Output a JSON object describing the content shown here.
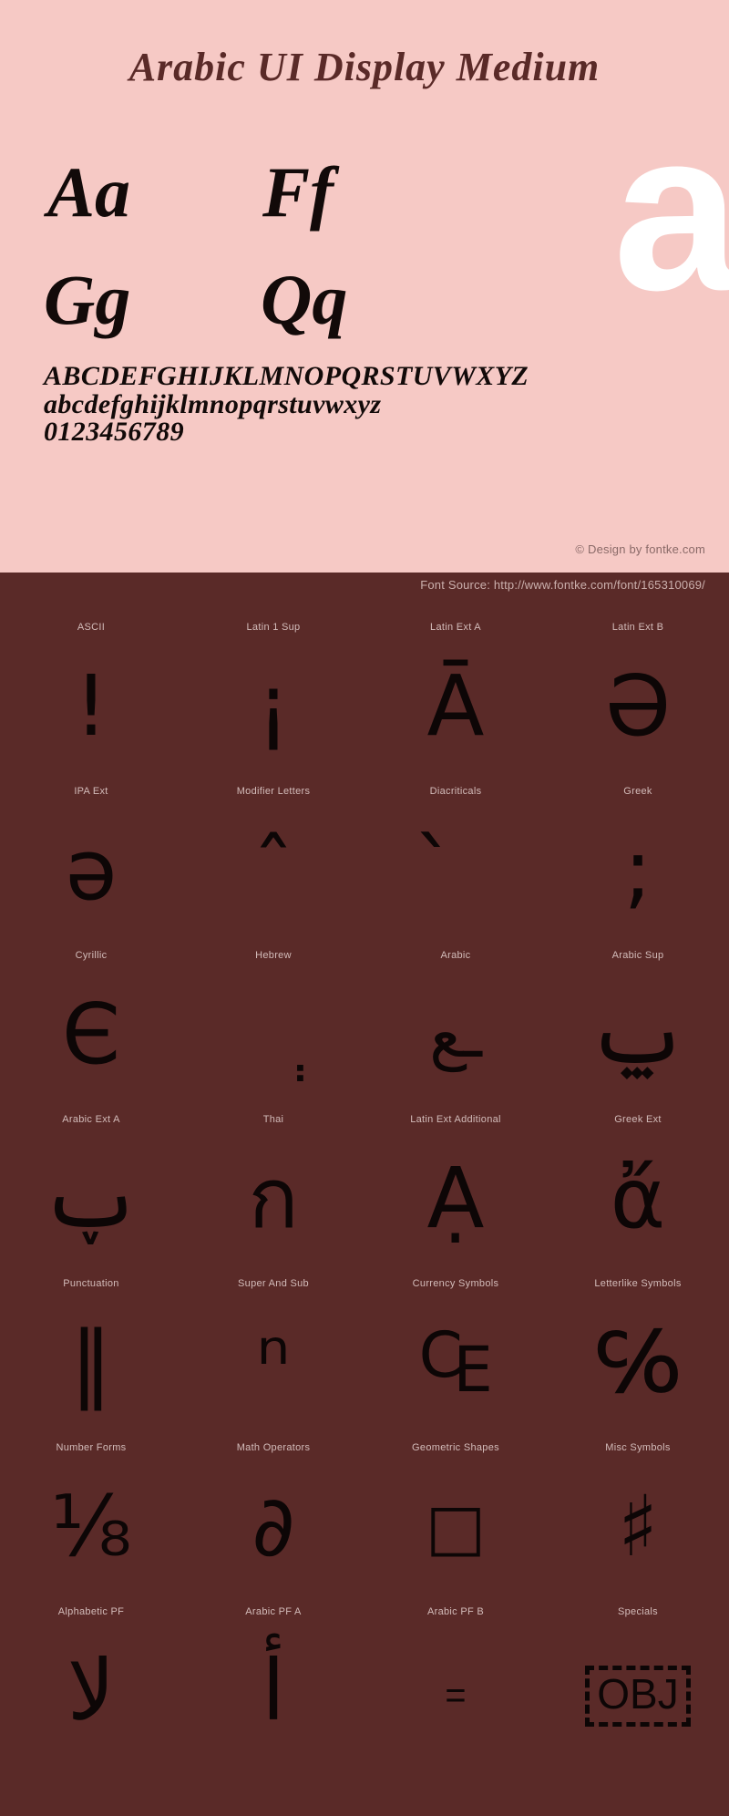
{
  "colors": {
    "panel_bg": "#f6c9c5",
    "page_bg": "#5a2a28",
    "ink": "#0d0606",
    "showcase": "#ffffff",
    "label": "#d3bcba"
  },
  "specimen": {
    "title": "Arabic UI Display Medium",
    "letter_pairs": [
      {
        "name": "pair-aa",
        "text": "Aa"
      },
      {
        "name": "pair-ff",
        "text": "Ff"
      },
      {
        "name": "pair-gg",
        "text": "Gg"
      },
      {
        "name": "pair-qq",
        "text": "Qq"
      }
    ],
    "showcase_glyph": "a",
    "alphabet": {
      "uppercase": "ABCDEFGHIJKLMNOPQRSTUVWXYZ",
      "lowercase": "abcdefghijklmnopqrstuvwxyz",
      "digits": "0123456789"
    },
    "credit": "© Design by fontke.com"
  },
  "source": {
    "text": "Font Source: http://www.fontke.com/font/165310069/"
  },
  "blocks": [
    [
      {
        "label": "ASCII",
        "glyph": "!",
        "size": ""
      },
      {
        "label": "Latin 1 Sup",
        "glyph": "¡",
        "size": ""
      },
      {
        "label": "Latin Ext A",
        "glyph": "Ā",
        "size": ""
      },
      {
        "label": "Latin Ext B",
        "glyph": "Ə",
        "size": ""
      }
    ],
    [
      {
        "label": "IPA Ext",
        "glyph": "ə",
        "size": ""
      },
      {
        "label": "Modifier Letters",
        "glyph": "ˆ",
        "size": ""
      },
      {
        "label": "Diacriticals",
        "glyph": "̀",
        "size": ""
      },
      {
        "label": "Greek",
        "glyph": ";",
        "size": ""
      }
    ],
    [
      {
        "label": "Cyrillic",
        "glyph": "Є",
        "size": ""
      },
      {
        "label": "Hebrew",
        "glyph": "ְ",
        "size": ""
      },
      {
        "label": "Arabic",
        "glyph": "ـع",
        "size": "small"
      },
      {
        "label": "Arabic Sup",
        "glyph": "ݐ",
        "size": ""
      }
    ],
    [
      {
        "label": "Arabic Ext A",
        "glyph": "ࢠ",
        "size": ""
      },
      {
        "label": "Thai",
        "glyph": "ก",
        "size": ""
      },
      {
        "label": "Latin Ext Additional",
        "glyph": "Ạ",
        "size": ""
      },
      {
        "label": "Greek Ext",
        "glyph": "ἄ",
        "size": ""
      }
    ],
    [
      {
        "label": "Punctuation",
        "glyph": "‖",
        "size": ""
      },
      {
        "label": "Super And Sub",
        "glyph": "ⁿ",
        "size": ""
      },
      {
        "label": "Currency Symbols",
        "glyph": "₠",
        "size": ""
      },
      {
        "label": "Letterlike Symbols",
        "glyph": "℅",
        "size": ""
      }
    ],
    [
      {
        "label": "Number Forms",
        "glyph": "⅛",
        "size": ""
      },
      {
        "label": "Math Operators",
        "glyph": "∂",
        "size": ""
      },
      {
        "label": "Geometric Shapes",
        "glyph": "□",
        "size": "small"
      },
      {
        "label": "Misc Symbols",
        "glyph": "♯",
        "size": ""
      }
    ],
    [
      {
        "label": "Alphabetic PF",
        "glyph": "ﻻ",
        "size": ""
      },
      {
        "label": "Arabic PF A",
        "glyph": "ﺃ",
        "size": ""
      },
      {
        "label": "Arabic PF B",
        "glyph": "﹦",
        "size": "tiny"
      },
      {
        "label": "Specials",
        "glyph": "OBJ",
        "size": "obj"
      }
    ]
  ]
}
